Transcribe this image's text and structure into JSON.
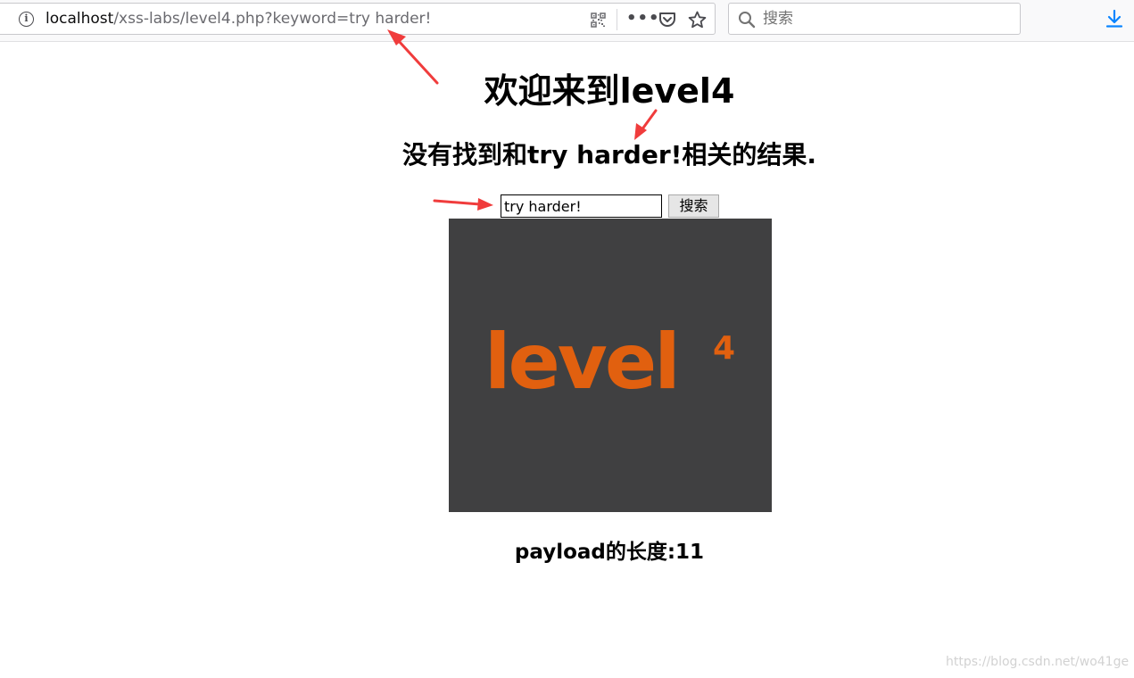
{
  "browser": {
    "url_host": "localhost",
    "url_path": "/xss-labs/level4.php?keyword=try harder!",
    "search_placeholder": "搜索",
    "toolbar_icons": [
      "info-icon",
      "qr-code-icon",
      "more-icon",
      "pocket-icon",
      "star-icon",
      "search-icon",
      "download-icon"
    ]
  },
  "page": {
    "heading": "欢迎来到level4",
    "result_text": "没有找到和try harder!相关的结果.",
    "keyword_value": "try harder!",
    "search_button_label": "搜索",
    "image_logo_text": "level",
    "image_logo_sup": "4",
    "payload_length_text": "payload的长度:11"
  },
  "annotations": {
    "arrow_color": "#f03c3c",
    "arrow_count": 3
  },
  "watermark": "https://blog.csdn.net/wo41ge",
  "colors": {
    "logo_orange": "#e1600f",
    "image_background": "#404041"
  }
}
